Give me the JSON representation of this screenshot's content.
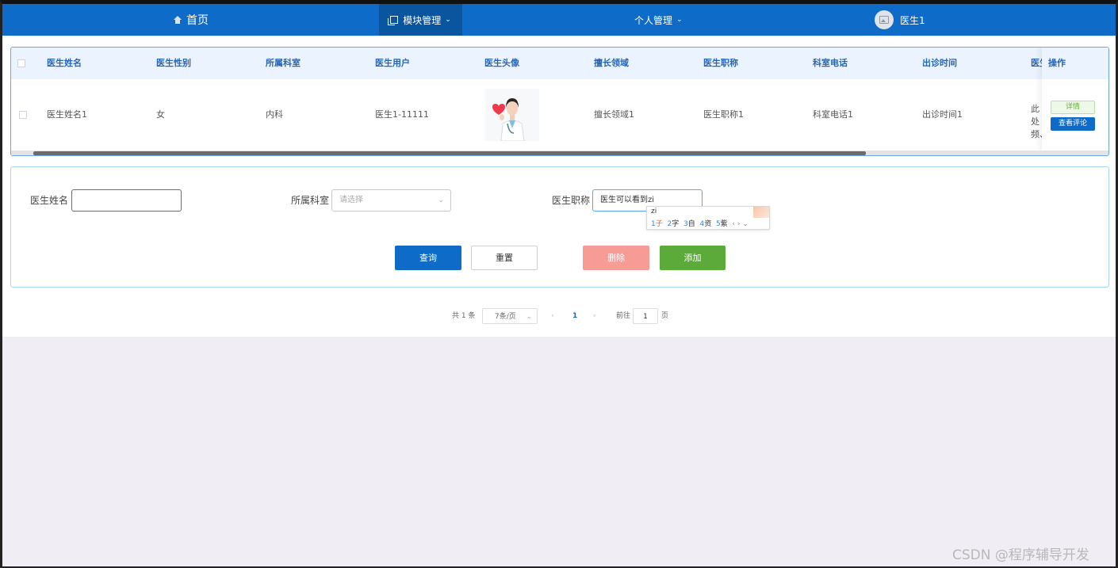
{
  "colors": {
    "primary": "#0f6bc8",
    "danger_light": "#f79b96",
    "success": "#5cab3a",
    "header_text": "#2566b8"
  },
  "nav": {
    "home": {
      "label": "首页",
      "icon": "home-icon"
    },
    "module": {
      "label": "模块管理",
      "icon": "copy-icon"
    },
    "personal": {
      "label": "个人管理"
    },
    "user": {
      "label": "医生1",
      "icon": "avatar-placeholder-icon"
    }
  },
  "table": {
    "columns": [
      "医生姓名",
      "医生性别",
      "所属科室",
      "医生用户",
      "医生头像",
      "擅长领域",
      "医生职称",
      "科室电话",
      "出诊时间",
      "医生",
      "操作"
    ],
    "rows": [
      {
        "name": "医生姓名1",
        "gender": "女",
        "dept": "内科",
        "user": "医生1-11111",
        "avatar": "doctor-photo",
        "field": "擅长领域1",
        "title": "医生职称1",
        "phone": "科室电话1",
        "time": "出诊时间1",
        "intro": "此处频、",
        "detail_btn": "详情",
        "review_btn": "查看评论"
      }
    ]
  },
  "search": {
    "name_label": "医生姓名",
    "name_value": "",
    "dept_label": "所属科室",
    "dept_placeholder": "请选择",
    "title_label": "医生职称",
    "title_value": "医生可以看到zi",
    "ime": {
      "composition": "zi",
      "candidates": [
        {
          "n": "1",
          "c": "子"
        },
        {
          "n": "2",
          "c": "字"
        },
        {
          "n": "3",
          "c": "自"
        },
        {
          "n": "4",
          "c": "资"
        },
        {
          "n": "5",
          "c": "紫"
        }
      ]
    },
    "query_btn": "查询",
    "reset_btn": "重置",
    "delete_btn": "删除",
    "add_btn": "添加"
  },
  "pager": {
    "total": "共 1 条",
    "page_size": "7条/页",
    "current": "1",
    "goto_label": "前往",
    "goto_value": "1",
    "page_suffix": "页"
  },
  "watermark": "CSDN @程序辅导开发"
}
